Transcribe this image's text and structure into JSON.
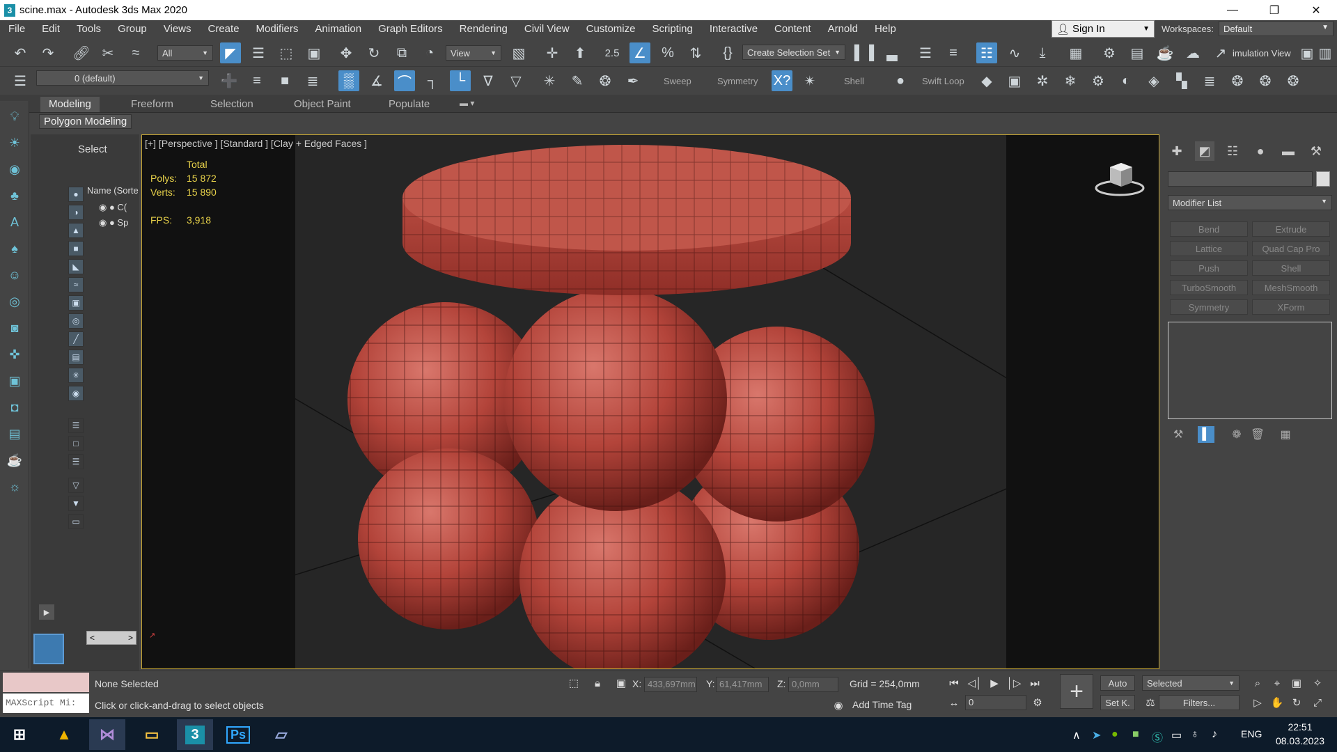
{
  "window": {
    "title": "scine.max - Autodesk 3ds Max 2020",
    "app_icon": "3"
  },
  "menu": [
    "File",
    "Edit",
    "Tools",
    "Group",
    "Views",
    "Create",
    "Modifiers",
    "Animation",
    "Graph Editors",
    "Rendering",
    "Civil View",
    "Customize",
    "Scripting",
    "Interactive",
    "Content",
    "Arnold",
    "Help"
  ],
  "account": {
    "sign_in": "Sign In",
    "workspaces_label": "Workspaces:",
    "workspace": "Default"
  },
  "toolbar": {
    "filter": "All",
    "ref_coord": "View",
    "selection_set": "Create Selection Set",
    "angle_snap": "2.5",
    "sim_view": "imulation View"
  },
  "toolbar2": {
    "layer": "0 (default)",
    "sweep": "Sweep",
    "symmetry": "Symmetry",
    "shell": "Shell",
    "swift_loop": "Swift Loop"
  },
  "ribbon": {
    "tabs": [
      "Modeling",
      "Freeform",
      "Selection",
      "Object Paint",
      "Populate"
    ],
    "active_tab": "Modeling",
    "panel": "Polygon Modeling"
  },
  "scene_explorer": {
    "title": "Select",
    "column": "Name (Sorte",
    "rows": [
      "C(",
      "Sp"
    ]
  },
  "viewport": {
    "label": "[+] [Perspective ] [Standard ] [Clay + Edged Faces ]",
    "stats": {
      "total_label": "Total",
      "polys_label": "Polys:",
      "polys": "15 872",
      "verts_label": "Verts:",
      "verts": "15 890",
      "fps_label": "FPS:",
      "fps": "3,918"
    }
  },
  "command_panel": {
    "modifier_list": "Modifier List",
    "modifiers": [
      "Bend",
      "Extrude",
      "Lattice",
      "Quad Cap Pro",
      "Push",
      "Shell",
      "TurboSmooth",
      "MeshSmooth",
      "Symmetry",
      "XForm"
    ]
  },
  "status": {
    "maxscript": "MAXScript Mi:",
    "selection": "None Selected",
    "prompt": "Click or click-and-drag to select objects",
    "x_label": "X:",
    "x": "433,697mm",
    "y_label": "Y:",
    "y": "61,417mm",
    "z_label": "Z:",
    "z": "0,0mm",
    "grid": "Grid = 254,0mm",
    "add_time_tag": "Add Time Tag",
    "frame": "0",
    "auto": "Auto",
    "setk": "Set K.",
    "key_filter": "Selected",
    "filters": "Filters..."
  },
  "taskbar": {
    "lang": "ENG",
    "time": "22:51",
    "date": "08.03.2023"
  },
  "colors": {
    "accent": "#4a8ec9",
    "viewport_border": "#c9a833",
    "stats": "#e8d24a",
    "mesh": "#b3443a"
  }
}
